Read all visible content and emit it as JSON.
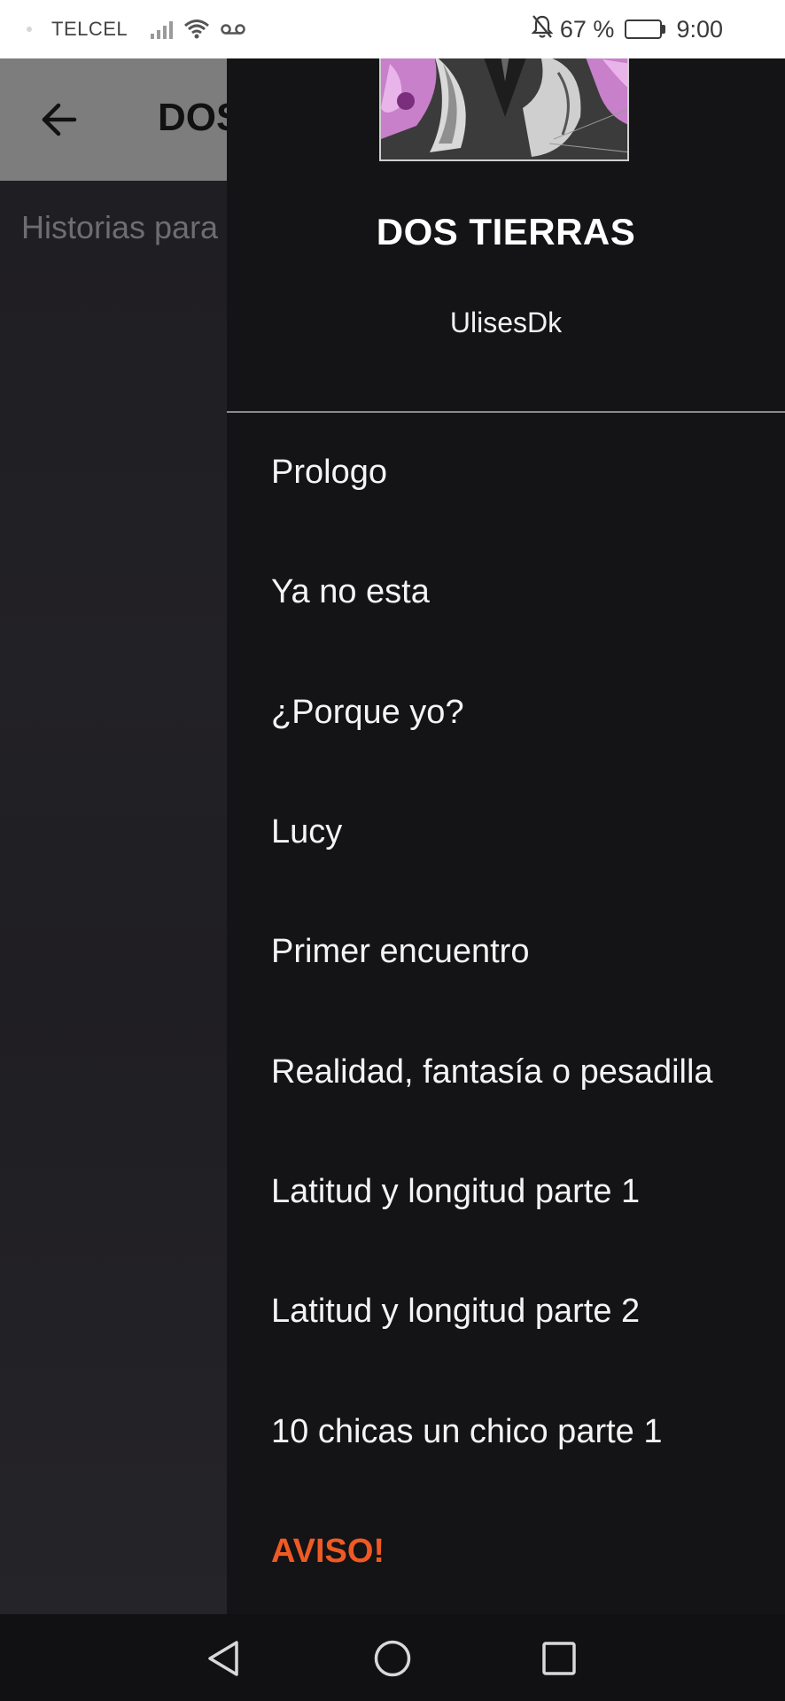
{
  "status_bar": {
    "carrier": "TELCEL",
    "battery": "67 %",
    "battery_level": 0.67,
    "time": "9:00",
    "icons": [
      "signal-icon",
      "wifi-icon",
      "voicemail-icon",
      "mute-bell-icon",
      "battery-icon"
    ]
  },
  "background": {
    "toolbar_title": "DOS TIERRAS",
    "subtitle": "Historias para"
  },
  "drawer": {
    "story_title": "DOS TIERRAS",
    "author": "UlisesDk",
    "chapters": [
      "Prologo",
      "Ya no esta",
      "¿Porque yo?",
      "Lucy",
      "Primer encuentro",
      "Realidad, fantasía o pesadilla",
      "Latitud y longitud parte 1",
      "Latitud y longitud parte 2",
      "10 chicas un chico parte 1",
      "AVISO!"
    ]
  },
  "colors": {
    "accent": "#ef5a24",
    "drawer_bg": "#141315",
    "toolbar_bg": "#7d7d7d"
  },
  "nav_bar": {
    "icons": [
      "back-triangle-icon",
      "home-circle-icon",
      "recents-square-icon"
    ]
  }
}
